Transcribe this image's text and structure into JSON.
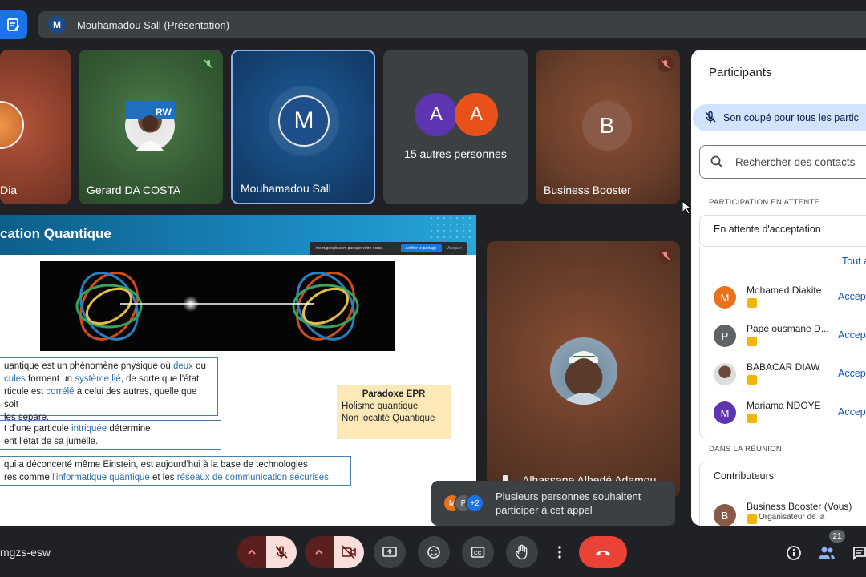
{
  "presentation": {
    "avatar_initial": "M",
    "title": "Mouhamadou Sall (Présentation)"
  },
  "tiles": {
    "dia": {
      "name": "Dia"
    },
    "gerard": {
      "name": "Gerard DA COSTA"
    },
    "mouhamadou": {
      "name": "Mouhamadou Sall",
      "initial": "M"
    },
    "others": {
      "initial_a": "A",
      "initial_b": "A",
      "label": "15 autres personnes"
    },
    "business": {
      "name": "Business Booster",
      "initial": "B"
    },
    "alhassane": {
      "name": "Alhassane Alhedé Adamou"
    }
  },
  "slide": {
    "title": "cation Quantique",
    "share_banner": {
      "text": "meet.google.com partage votre écran.",
      "stop": "Arrêter le partage",
      "hide": "Masquer"
    },
    "box1": {
      "l1a": "uantique est un phénomène physique où ",
      "l1b": "deux",
      "l1c": " ou",
      "l2a": "cules",
      "l2b": " forment un ",
      "l2c": "système lié",
      "l2d": ", de sorte que l'état",
      "l3a": "rticule est ",
      "l3b": "corrélé",
      "l3c": " à celui des autres, quelle que soit",
      "l4": " les sépare."
    },
    "box2": {
      "l1a": "t d'une particule ",
      "l1b": "intriquée",
      "l1c": " détermine",
      "l2": "ent l'état de sa jumelle."
    },
    "box3": {
      "l1": "qui a déconcerté même Einstein, est aujourd'hui à la base de technologies",
      "l2a": "res comme ",
      "l2b": "l'informatique quantique",
      "l2c": " et les ",
      "l2d": "réseaux de communication sécurisés",
      "l2e": "."
    },
    "epr": {
      "title": "Paradoxe EPR",
      "l1": "Holisme quantique",
      "l2": "Non localité Quantique"
    }
  },
  "toast": {
    "avatars": [
      "M",
      "P",
      "+2"
    ],
    "line1": "Plusieurs personnes souhaitent",
    "line2": "participer à cet appel"
  },
  "panel": {
    "title": "Participants",
    "muted_banner": "Son coupé pour tous les partic",
    "search_placeholder": "Rechercher des contacts",
    "waiting_section": "PARTICIPATION EN ATTENTE",
    "waiting_group": "En attente d'acceptation",
    "accept_all": "Tout a",
    "waiting": [
      {
        "initial": "M",
        "name": "Mohamed Diakite",
        "action": "Accep",
        "color": "#e8711a"
      },
      {
        "initial": "P",
        "name": "Pape ousmane D...",
        "action": "Accep",
        "color": "#5f6368"
      },
      {
        "initial": "",
        "name": "BABACAR DIAW",
        "action": "Accep",
        "color": "#8d6e63"
      },
      {
        "initial": "M",
        "name": "Mariama NDOYE",
        "action": "Accep",
        "color": "#5e35b1"
      }
    ],
    "in_meeting_section": "DANS LA RÉUNION",
    "contributors_group": "Contributeurs",
    "me": {
      "initial": "B",
      "name": "Business Booster (Vous)",
      "role": "Organisateur de la"
    }
  },
  "bottom": {
    "meeting_code": "mgzs-esw",
    "participant_count": "21"
  },
  "colors": {
    "accent": "#1a73e8",
    "end_call": "#ea4335",
    "muted_bg": "#f9dedc"
  }
}
